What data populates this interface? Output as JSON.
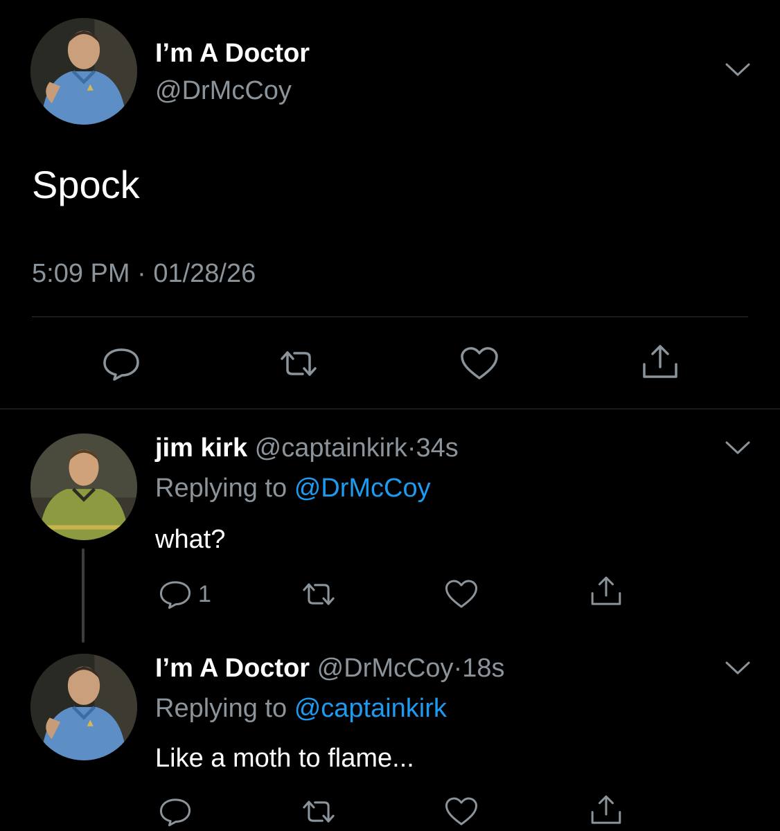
{
  "main_tweet": {
    "display_name": "I’m A Doctor",
    "handle": "@DrMcCoy",
    "text": "Spock",
    "time": "5:09 PM",
    "date_separator": "·",
    "date": "01/28/26",
    "actions": [
      "reply-icon",
      "retweet-icon",
      "like-icon",
      "share-icon"
    ]
  },
  "replies": [
    {
      "display_name": "jim kirk",
      "handle": "@captainkirk",
      "separator": "·",
      "age": "34s",
      "replying_prefix": "Replying to",
      "replying_to": "@DrMcCoy",
      "text": "what?",
      "reply_count": "1"
    },
    {
      "display_name": "I’m A Doctor",
      "handle": "@DrMcCoy",
      "separator": "·",
      "age": "18s",
      "replying_prefix": "Replying to",
      "replying_to": "@captainkirk",
      "text": "Like a moth to flame..."
    }
  ],
  "colors": {
    "background": "#000000",
    "text": "#ffffff",
    "muted": "#8b949b",
    "link": "#1d9bf0",
    "divider": "#2f3336",
    "mccoy_shirt": "#5d8ec5",
    "kirk_shirt": "#8d9a3f"
  }
}
